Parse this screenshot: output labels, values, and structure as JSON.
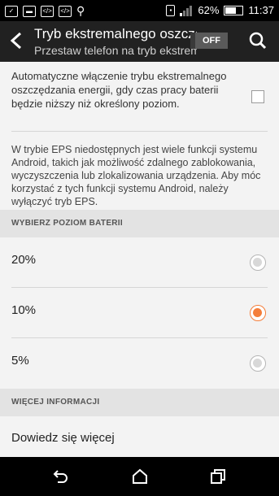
{
  "status_bar": {
    "battery_percent": "62%",
    "time": "11:37",
    "icons": [
      "notification-icon",
      "photo-icon",
      "code-icon",
      "code-icon",
      "usb-icon",
      "sim-icon",
      "signal-icon",
      "battery-icon"
    ]
  },
  "app_bar": {
    "title": "Tryb ekstremalnego oszczędzania energii",
    "subtitle": "Przestaw telefon na tryb ekstremalnego oszczędzania",
    "toggle_label": "OFF"
  },
  "auto_switch": {
    "text": "Automatyczne włączenie trybu ekstremalnego oszczędzania energii, gdy czas pracy baterii będzie niższy niż określony poziom.",
    "checked": false
  },
  "info_text": "W trybie EPS niedostępnych jest wiele funkcji systemu Android, takich jak możliwość zdalnego zablokowania, wyczyszczenia lub zlokalizowania urządzenia. Aby móc korzystać z tych funkcji systemu Android, należy wyłączyć tryb EPS.",
  "battery_section": {
    "header": "WYBIERZ POZIOM BATERII",
    "options": [
      {
        "label": "20%",
        "selected": false
      },
      {
        "label": "10%",
        "selected": true
      },
      {
        "label": "5%",
        "selected": false
      }
    ]
  },
  "more_section": {
    "header": "WIĘCEJ INFORMACJI",
    "link": "Dowiedz się więcej"
  },
  "colors": {
    "accent": "#f47e3a",
    "appbar": "#212121"
  }
}
